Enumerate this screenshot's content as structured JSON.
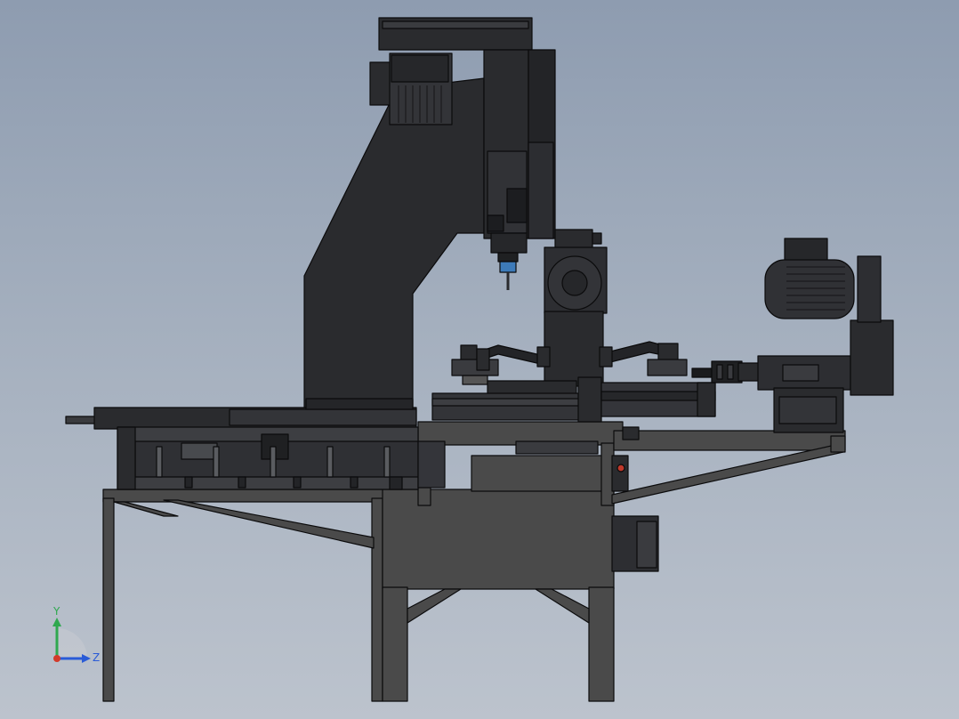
{
  "viewport": {
    "background_top": "#8e9cb0",
    "background_bottom": "#bcc3cd"
  },
  "model": {
    "colors": {
      "dark_body": "#2a2b2e",
      "darker": "#1a1b1d",
      "frame": "#4a4a4a",
      "edge": "#0b0b0c",
      "highlight": "#5a5c60",
      "accent_red": "#c0392b",
      "accent_blue": "#3d7ab8"
    }
  },
  "triad": {
    "y_label": "Y",
    "z_label": "Z",
    "y_color": "#2fa84f",
    "z_color": "#2a5bd7",
    "x_color": "#d23a2a"
  }
}
